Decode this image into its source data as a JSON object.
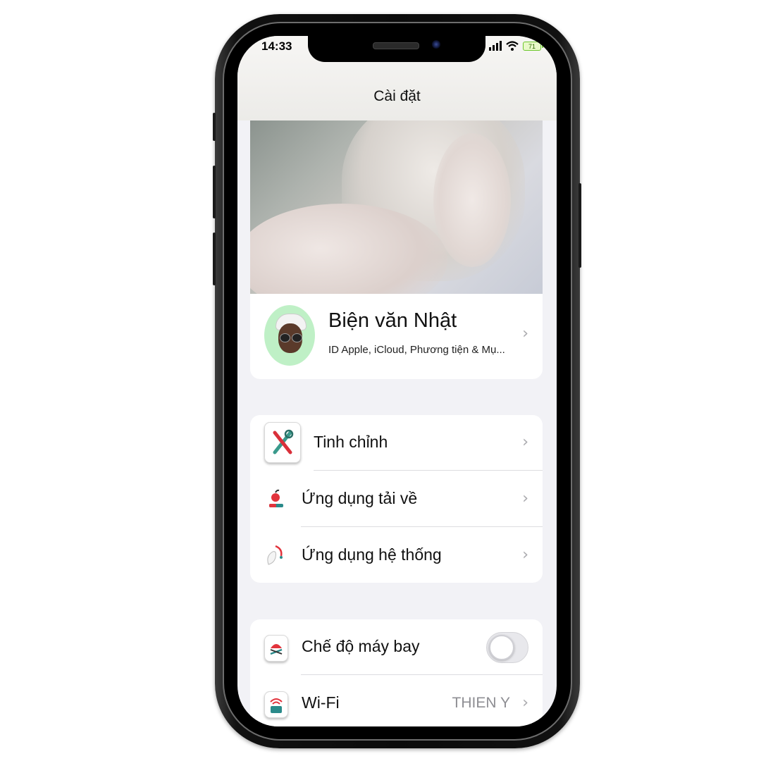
{
  "status_bar": {
    "time": "14:33",
    "battery": "71"
  },
  "nav": {
    "title": "Cài đặt"
  },
  "profile": {
    "name": "Biện văn Nhật",
    "subtitle": "ID Apple, iCloud, Phương tiện & Mụ..."
  },
  "group1": {
    "items": [
      {
        "label": "Tinh chỉnh",
        "icon": "tools-icon"
      },
      {
        "label": "Ứng dụng tải về",
        "icon": "downloaded-apps-icon"
      },
      {
        "label": "Ứng dụng hệ thống",
        "icon": "system-apps-icon"
      }
    ]
  },
  "group2": {
    "items": [
      {
        "label": "Chế độ máy bay",
        "icon": "airplane-mode-icon",
        "toggle_on": false
      },
      {
        "label": "Wi-Fi",
        "icon": "wifi-settings-icon",
        "value": "THIEN Y"
      }
    ]
  },
  "chevron": "›",
  "colors": {
    "background": "#f2f2f6",
    "battery": "#6cc72c",
    "avatar_bg": "#bff0c6"
  }
}
